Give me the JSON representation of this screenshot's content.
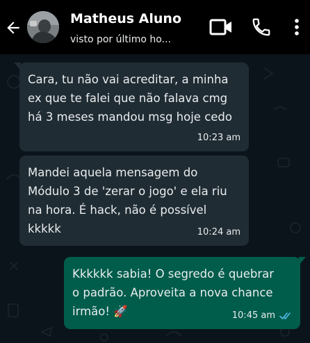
{
  "header": {
    "contact_name": "Matheus Aluno",
    "status": "visto por último ho...",
    "icons": {
      "back": "arrow-left-icon",
      "video": "video-camera-icon",
      "call": "phone-icon",
      "menu": "more-vertical-icon"
    }
  },
  "messages": [
    {
      "direction": "incoming",
      "text": "Cara, tu não vai acreditar, a minha\nex que te falei que não falava cmg\nhá 3 meses mandou msg hoje cedo",
      "time": "10:23 am"
    },
    {
      "direction": "incoming",
      "text": "Mandei aquela mensagem do\nMódulo 3 de 'zerar o jogo' e ela riu\nna hora. É hack, não é possível\nkkkkk",
      "time": "10:24 am"
    },
    {
      "direction": "outgoing",
      "text": "Kkkkkk sabia! O segredo é quebrar\no padrão. Aproveita a nova chance\nirmão! 🚀",
      "time": "10:45 am",
      "status_icon": "double-check-read-icon"
    }
  ],
  "colors": {
    "header_bg": "#000000",
    "chat_bg": "#0b141a",
    "incoming_bubble": "#202c33",
    "outgoing_bubble": "#005c4b",
    "read_ticks": "#53bdeb",
    "text": "#e9edef"
  }
}
